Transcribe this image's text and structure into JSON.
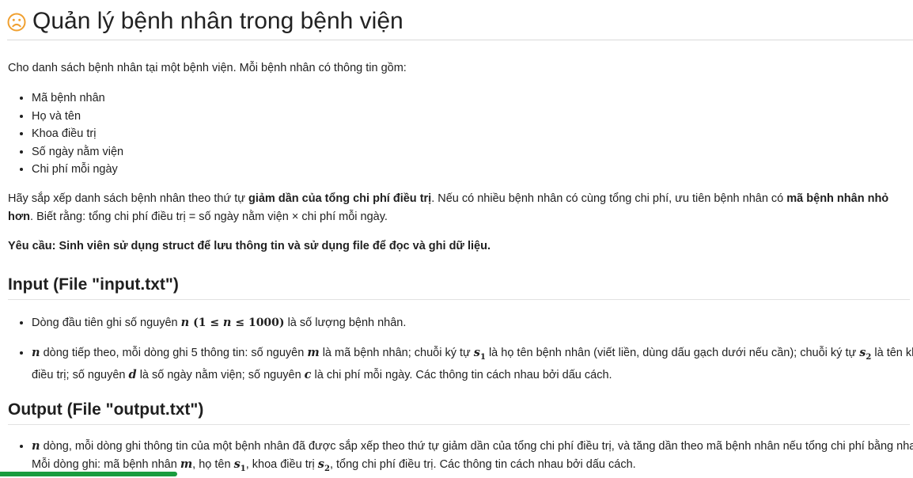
{
  "title": "Quản lý bệnh nhân trong bệnh viện",
  "intro": "Cho danh sách bệnh nhân tại một bệnh viện. Mỗi bệnh nhân có thông tin gồm:",
  "fields": [
    "Mã bệnh nhân",
    "Họ và tên",
    "Khoa điều trị",
    "Số ngày nằm viện",
    "Chi phí mỗi ngày"
  ],
  "task": {
    "t1": "Hãy sắp xếp danh sách bệnh nhân theo thứ tự ",
    "b1": "giảm dần của tổng chi phí điều trị",
    "t2": ". Nếu có nhiều bệnh nhân có cùng tổng chi phí, ưu tiên bệnh nhân có ",
    "b2": "mã bệnh nhân nhỏ hơn",
    "t3": ". Biết rằng: tổng chi phí điều trị = số ngày nằm viện × chi phí mỗi ngày."
  },
  "requirement": "Yêu cầu: Sinh viên sử dụng struct để lưu thông tin và sử dụng file để đọc và ghi dữ liệu.",
  "input_heading": "Input (File \"input.txt\")",
  "input": {
    "i1_a": "Dòng đầu tiên ghi số nguyên ",
    "i1_n": "n",
    "i1_cond_open": " (1 ≤ ",
    "i1_cond_n": "n",
    "i1_cond_close": " ≤ 1000)",
    "i1_b": " là số lượng bệnh nhân.",
    "i2_n": "n",
    "i2_a": " dòng tiếp theo, mỗi dòng ghi 5 thông tin: số nguyên ",
    "i2_m": "m",
    "i2_b": " là mã bệnh nhân; chuỗi ký tự ",
    "i2_s1": "s",
    "i2_s1_sub": "1",
    "i2_c": " là họ tên bệnh nhân (viết liền, dùng dấu gạch dưới nếu cần); chuỗi ký tự ",
    "i2_s2": "s",
    "i2_s2_sub": "2",
    "i2_d": " là tên khoa điều trị; số nguyên ",
    "i2_dvar": "d",
    "i2_e": " là số ngày nằm viện; số nguyên ",
    "i2_cvar": "c",
    "i2_f": " là chi phí mỗi ngày. Các thông tin cách nhau bởi dấu cách."
  },
  "output_heading": "Output (File \"output.txt\")",
  "output": {
    "o_n": "n",
    "o_a": " dòng, mỗi dòng ghi thông tin của một bệnh nhân đã được sắp xếp theo thứ tự giảm dần của tổng chi phí điều trị, và tăng dần theo mã bệnh nhân nếu tổng chi phí bằng nhau. Mỗi dòng ghi: mã bệnh nhân ",
    "o_m": "m",
    "o_b": ", họ tên ",
    "o_s1": "s",
    "o_s1_sub": "1",
    "o_c": ", khoa điều trị ",
    "o_s2": "s",
    "o_s2_sub": "2",
    "o_d": ", tổng chi phí điều trị. Các thông tin cách nhau bởi dấu cách."
  },
  "colors": {
    "icon": "#f0a030",
    "progress": "#1a9c3e"
  }
}
